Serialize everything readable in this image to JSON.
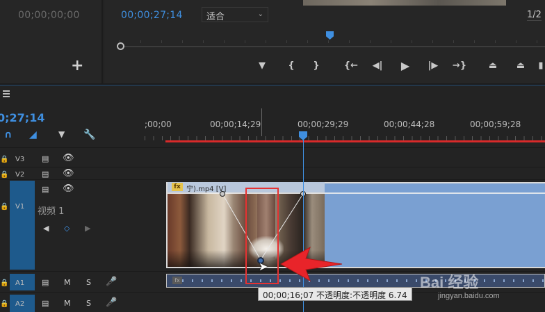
{
  "source_monitor": {
    "timecode": "00;00;00;00",
    "add_button": "+"
  },
  "program_monitor": {
    "timecode": "00;00;27;14",
    "zoom_select": "适合",
    "page_count": "1/2",
    "transport": {
      "add_marker": "▼",
      "mark_in": "{",
      "mark_out": "}",
      "go_to_in": "{←",
      "step_back": "◀|",
      "play": "▶",
      "step_forward": "|▶",
      "go_to_out": "→}",
      "lift": "⏏",
      "extract": "⏏",
      "more": "▮"
    }
  },
  "timeline": {
    "timecode": "0;27;14",
    "ruler_labels": [
      ";00;00",
      "00;00;14;29",
      "00;00;29;29",
      "00;00;44;28",
      "00;00;59;28"
    ],
    "tracks": {
      "v3": "V3",
      "v2": "V2",
      "v1": "V1",
      "v1_name": "视频 1",
      "a1": "A1",
      "a2": "A2",
      "mute": "M",
      "solo": "S"
    },
    "clip": {
      "fx_badge": "fx",
      "title": "宁).mp4 [V]"
    },
    "audio_clip": {
      "fx_badge": "fx"
    },
    "tooltip": "00;00;16;07  不透明度:不透明度  6.74",
    "accent_color": "#3f8fe0",
    "render_bar_color": "#d82a2a",
    "highlight_color": "#e63232"
  },
  "watermark": {
    "text": "Bai 经验",
    "sub": "jingyan.baidu.com"
  }
}
